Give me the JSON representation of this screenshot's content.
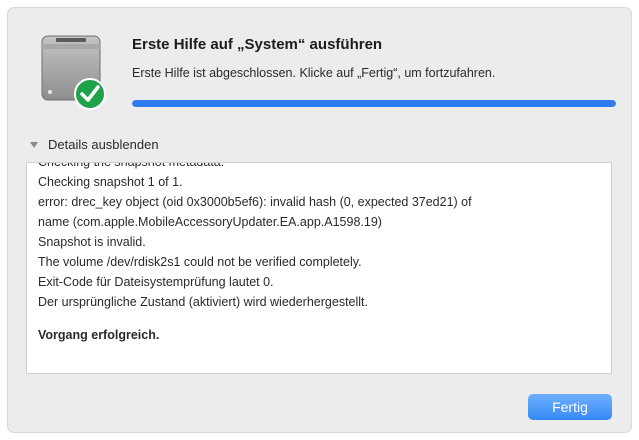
{
  "dialog": {
    "title": "Erste Hilfe auf „System“ ausführen",
    "subtitle": "Erste Hilfe ist abgeschlossen. Klicke auf „Fertig“, um fortzufahren.",
    "progress_fraction": 1.0,
    "accent_color": "#2f7cf0",
    "icons": {
      "disk": "hard-disk-icon",
      "check": "checkmark-badge-icon",
      "disclosure": "disclosure-triangle-icon"
    }
  },
  "details": {
    "toggle_label": "Details ausblenden"
  },
  "log": {
    "partial_first_line": "Checking the snapshot metadata.",
    "lines": [
      "Checking snapshot 1 of 1.",
      "error: drec_key object (oid 0x3000b5ef6): invalid hash (0, expected 37ed21) of",
      "name (com.apple.MobileAccessoryUpdater.EA.app.A1598.19)",
      "Snapshot is invalid.",
      "The volume /dev/rdisk2s1 could not be verified completely.",
      "Exit-Code für Dateisystemprüfung lautet 0.",
      "Der ursprüngliche Zustand (aktiviert) wird wiederhergestellt."
    ],
    "result": "Vorgang erfolgreich."
  },
  "buttons": {
    "done_label": "Fertig"
  }
}
